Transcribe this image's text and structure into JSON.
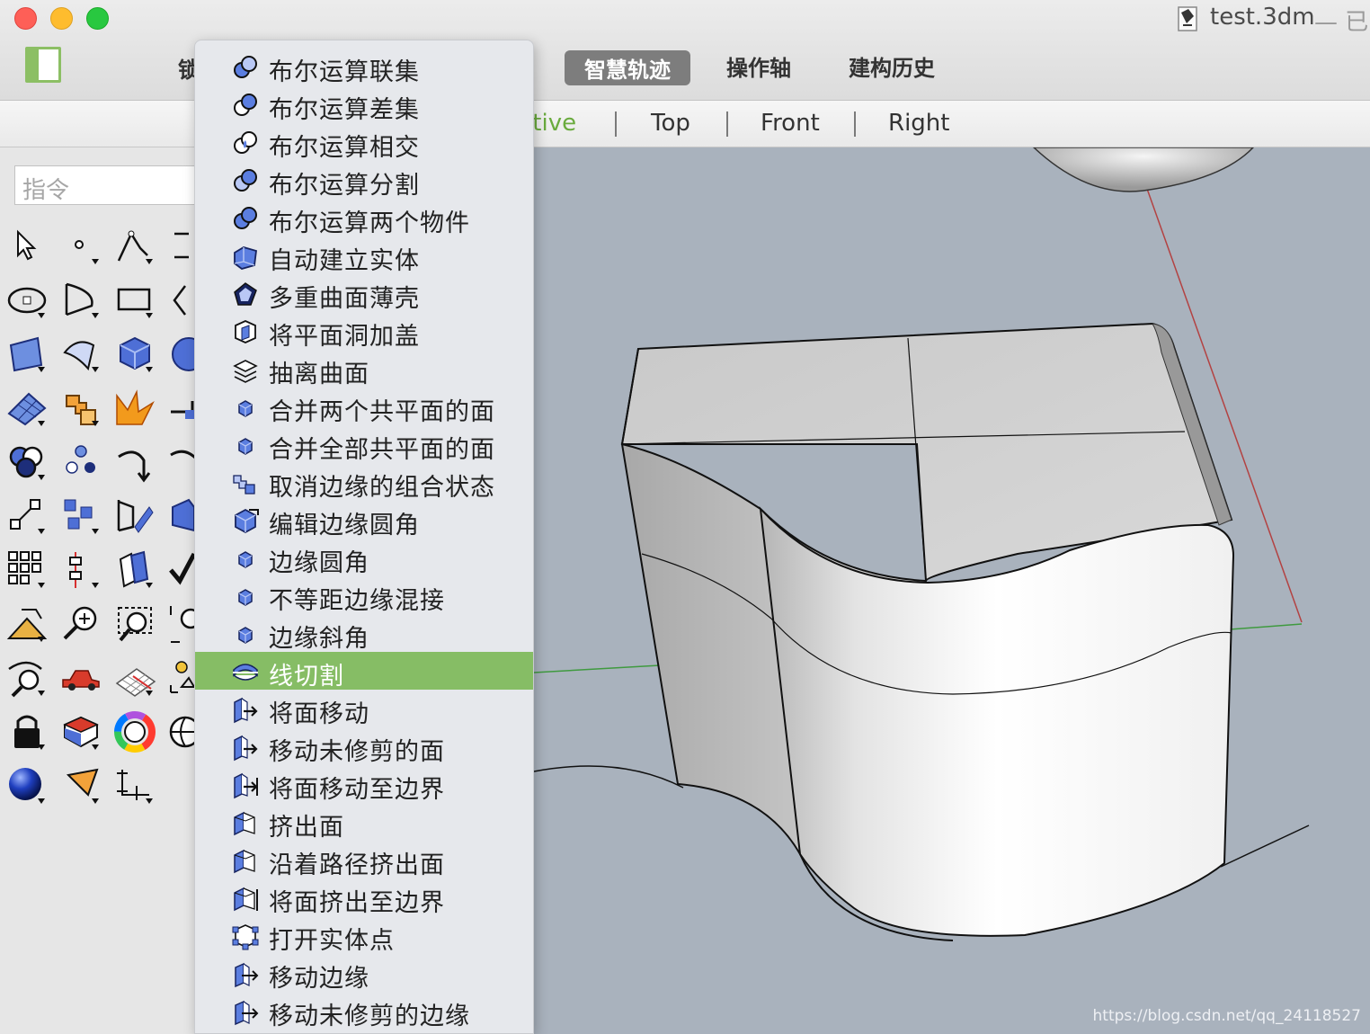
{
  "window": {
    "title": "test.3dm",
    "title_suffix": "— 已"
  },
  "toolbar_tabs": {
    "partial": "锁",
    "tabs": [
      {
        "label": "智慧轨迹",
        "active": true
      },
      {
        "label": "操作轴",
        "active": false
      },
      {
        "label": "建构历史",
        "active": false
      }
    ]
  },
  "viewports": {
    "tabs": [
      {
        "label": "ctive",
        "active": true
      },
      {
        "label": "Top",
        "active": false
      },
      {
        "label": "Front",
        "active": false
      },
      {
        "label": "Right",
        "active": false
      }
    ]
  },
  "command": {
    "placeholder": "指令"
  },
  "solid_menu": {
    "items": [
      {
        "label": "布尔运算联集",
        "icon": "boolean-union-icon"
      },
      {
        "label": "布尔运算差集",
        "icon": "boolean-difference-icon"
      },
      {
        "label": "布尔运算相交",
        "icon": "boolean-intersection-icon"
      },
      {
        "label": "布尔运算分割",
        "icon": "boolean-split-icon"
      },
      {
        "label": "布尔运算两个物件",
        "icon": "boolean-two-objects-icon"
      },
      {
        "label": "自动建立实体",
        "icon": "create-solid-icon"
      },
      {
        "label": "多重曲面薄壳",
        "icon": "shell-icon"
      },
      {
        "label": "将平面洞加盖",
        "icon": "cap-icon"
      },
      {
        "label": "抽离曲面",
        "icon": "extract-surface-icon"
      },
      {
        "label": "合并两个共平面的面",
        "icon": "merge-face-icon"
      },
      {
        "label": "合并全部共平面的面",
        "icon": "merge-all-faces-icon"
      },
      {
        "label": "取消边缘的组合状态",
        "icon": "unjoin-edge-icon"
      },
      {
        "label": "编辑边缘圆角",
        "icon": "fillet-edit-icon"
      },
      {
        "label": "边缘圆角",
        "icon": "fillet-edge-icon"
      },
      {
        "label": "不等距边缘混接",
        "icon": "blend-edge-icon"
      },
      {
        "label": "边缘斜角",
        "icon": "chamfer-edge-icon"
      },
      {
        "label": "线切割",
        "icon": "wire-cut-icon",
        "selected": true
      },
      {
        "label": "将面移动",
        "icon": "move-face-icon"
      },
      {
        "label": "移动未修剪的面",
        "icon": "move-untrimmed-face-icon"
      },
      {
        "label": "将面移动至边界",
        "icon": "move-face-to-boundary-icon"
      },
      {
        "label": "挤出面",
        "icon": "extrude-face-icon"
      },
      {
        "label": "沿着路径挤出面",
        "icon": "extrude-face-along-path-icon"
      },
      {
        "label": "将面挤出至边界",
        "icon": "extrude-face-to-boundary-icon"
      },
      {
        "label": "打开实体点",
        "icon": "solid-points-icon"
      },
      {
        "label": "移动边缘",
        "icon": "move-edge-icon"
      },
      {
        "label": "移动未修剪的边缘",
        "icon": "move-untrimmed-edge-icon"
      }
    ]
  },
  "watermark": "https://blog.csdn.net/qq_24118527"
}
